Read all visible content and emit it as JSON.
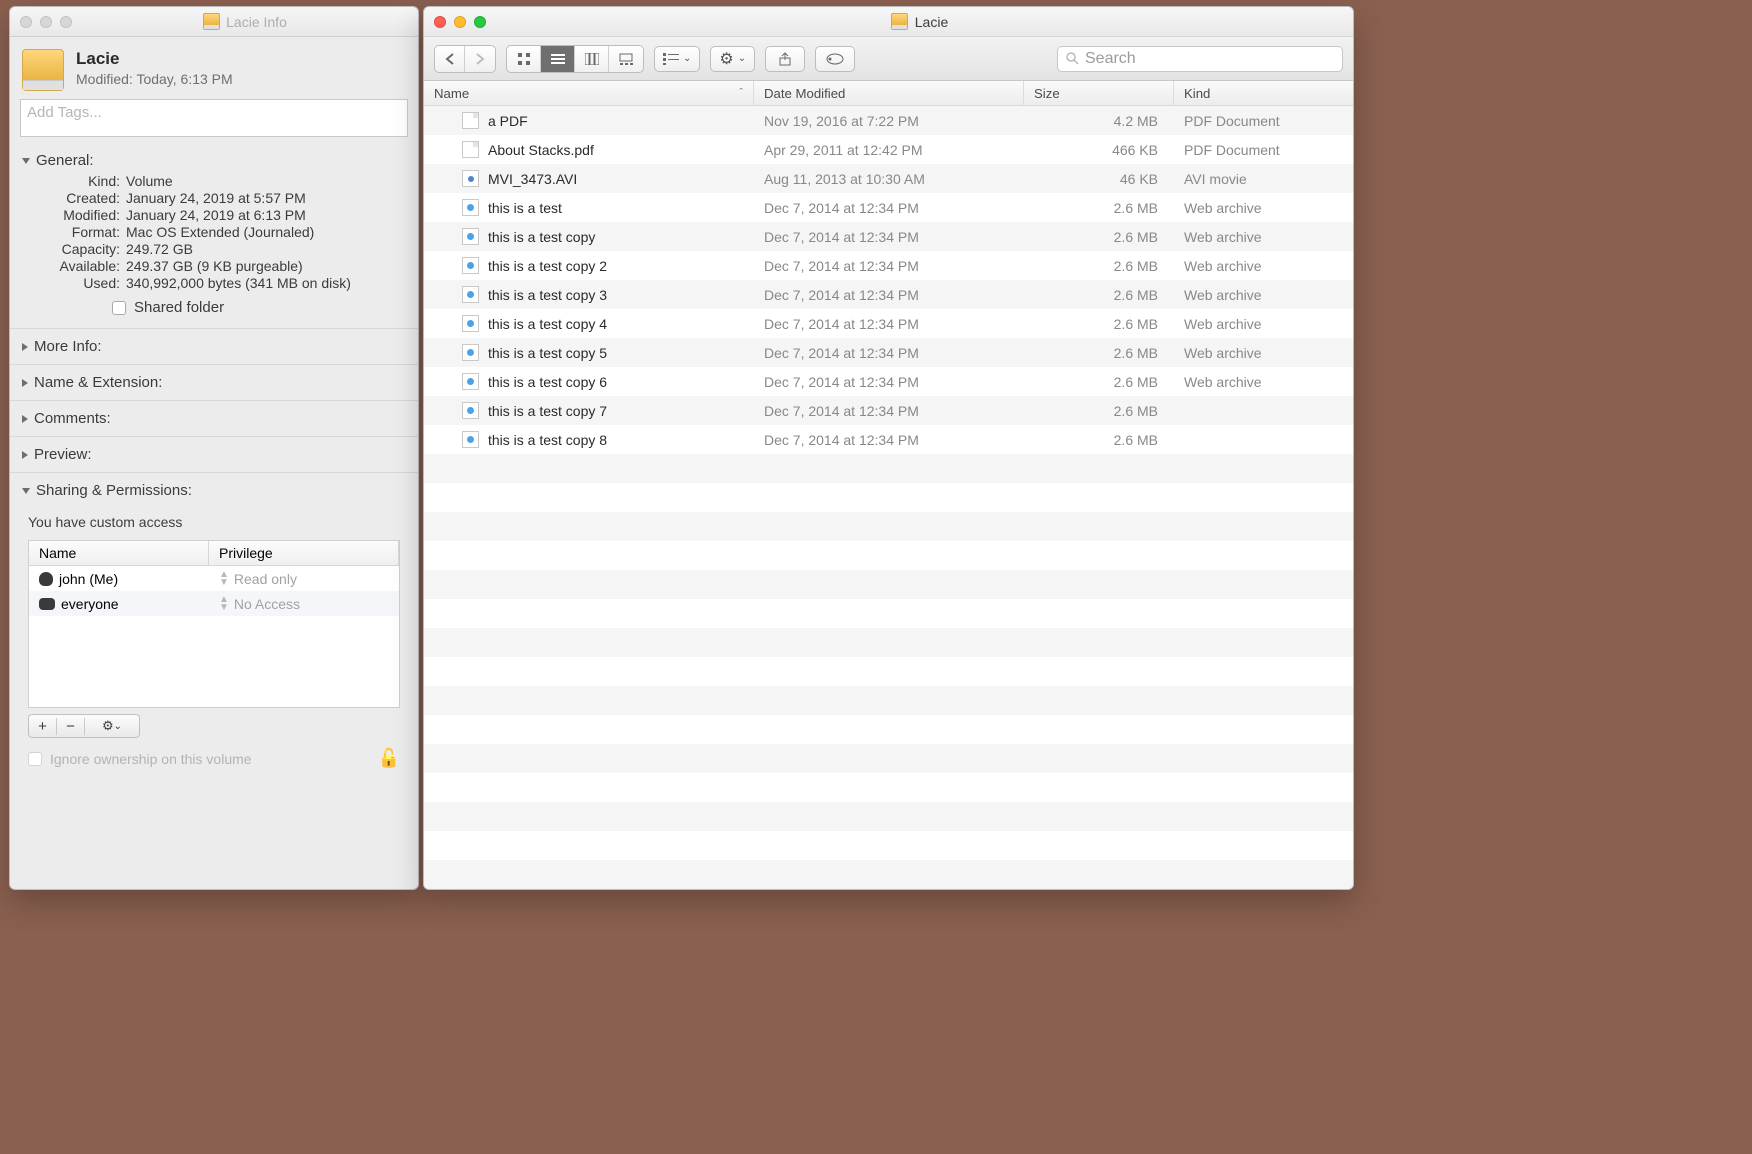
{
  "info": {
    "window_title": "Lacie Info",
    "name": "Lacie",
    "modified": "Modified: Today, 6:13 PM",
    "tags_placeholder": "Add Tags...",
    "sections": {
      "general": "General:",
      "more_info": "More Info:",
      "name_ext": "Name & Extension:",
      "comments": "Comments:",
      "preview": "Preview:",
      "sharing": "Sharing & Permissions:"
    },
    "general": {
      "kind_k": "Kind:",
      "kind_v": "Volume",
      "created_k": "Created:",
      "created_v": "January 24, 2019 at 5:57 PM",
      "modified_k": "Modified:",
      "modified_v": "January 24, 2019 at 6:13 PM",
      "format_k": "Format:",
      "format_v": "Mac OS Extended (Journaled)",
      "capacity_k": "Capacity:",
      "capacity_v": "249.72 GB",
      "available_k": "Available:",
      "available_v": "249.37 GB (9 KB purgeable)",
      "used_k": "Used:",
      "used_v": "340,992,000 bytes (341 MB on disk)",
      "shared_folder": "Shared folder"
    },
    "perm_note": "You have custom access",
    "perm_headers": {
      "name": "Name",
      "priv": "Privilege"
    },
    "perm_rows": [
      {
        "name": "john (Me)",
        "priv": "Read only",
        "type": "user"
      },
      {
        "name": "everyone",
        "priv": "No Access",
        "type": "group"
      }
    ],
    "ignore_label": "Ignore ownership on this volume"
  },
  "finder": {
    "title": "Lacie",
    "search_placeholder": "Search",
    "columns": {
      "name": "Name",
      "date": "Date Modified",
      "size": "Size",
      "kind": "Kind"
    },
    "rows": [
      {
        "icon": "pdf",
        "name": "a PDF",
        "date": "Nov 19, 2016 at 7:22 PM",
        "size": "4.2 MB",
        "kind": "PDF Document"
      },
      {
        "icon": "pdf",
        "name": "About Stacks.pdf",
        "date": "Apr 29, 2011 at 12:42 PM",
        "size": "466 KB",
        "kind": "PDF Document"
      },
      {
        "icon": "avi",
        "name": "MVI_3473.AVI",
        "date": "Aug 11, 2013 at 10:30 AM",
        "size": "46 KB",
        "kind": "AVI movie"
      },
      {
        "icon": "web",
        "name": "this is a test",
        "date": "Dec 7, 2014 at 12:34 PM",
        "size": "2.6 MB",
        "kind": "Web archive"
      },
      {
        "icon": "web",
        "name": "this is a test copy",
        "date": "Dec 7, 2014 at 12:34 PM",
        "size": "2.6 MB",
        "kind": "Web archive"
      },
      {
        "icon": "web",
        "name": "this is a test copy 2",
        "date": "Dec 7, 2014 at 12:34 PM",
        "size": "2.6 MB",
        "kind": "Web archive"
      },
      {
        "icon": "web",
        "name": "this is a test copy 3",
        "date": "Dec 7, 2014 at 12:34 PM",
        "size": "2.6 MB",
        "kind": "Web archive"
      },
      {
        "icon": "web",
        "name": "this is a test copy 4",
        "date": "Dec 7, 2014 at 12:34 PM",
        "size": "2.6 MB",
        "kind": "Web archive"
      },
      {
        "icon": "web",
        "name": "this is a test copy 5",
        "date": "Dec 7, 2014 at 12:34 PM",
        "size": "2.6 MB",
        "kind": "Web archive"
      },
      {
        "icon": "web",
        "name": "this is a test copy 6",
        "date": "Dec 7, 2014 at 12:34 PM",
        "size": "2.6 MB",
        "kind": "Web archive"
      },
      {
        "icon": "web",
        "name": "this is a test copy 7",
        "date": "Dec 7, 2014 at 12:34 PM",
        "size": "2.6 MB",
        "kind": ""
      },
      {
        "icon": "web",
        "name": "this is a test copy 8",
        "date": "Dec 7, 2014 at 12:34 PM",
        "size": "2.6 MB",
        "kind": ""
      }
    ]
  }
}
